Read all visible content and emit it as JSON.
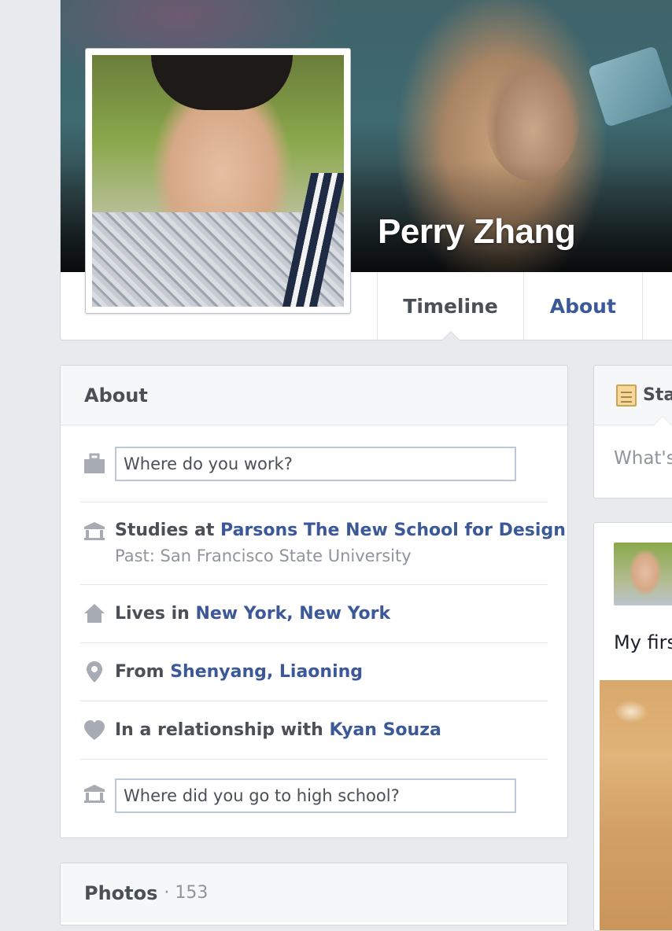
{
  "profile": {
    "name": "Perry Zhang"
  },
  "tabs": [
    {
      "label": "Timeline",
      "active": true
    },
    {
      "label": "About",
      "active": false
    }
  ],
  "about": {
    "title": "About",
    "work_placeholder": "Where do you work?",
    "education": {
      "prefix": "Studies at",
      "school": "Parsons The New School for Design",
      "past": "Past: San Francisco State University"
    },
    "lives": {
      "prefix": "Lives in",
      "place": "New York, New York"
    },
    "from": {
      "prefix": "From",
      "place": "Shenyang, Liaoning"
    },
    "relationship": {
      "prefix": "In a relationship with",
      "partner": "Kyan Souza"
    },
    "highschool_placeholder": "Where did you go to high school?"
  },
  "photos": {
    "title": "Photos",
    "separator": "·",
    "count": "153"
  },
  "status": {
    "tab_label": "Sta",
    "prompt": "What's"
  },
  "post": {
    "text": "My firs"
  },
  "colors": {
    "link": "#3b5998",
    "text": "#4b4f56",
    "muted": "#90949c",
    "background": "#e9eaed",
    "icon": "#a7abb3"
  }
}
